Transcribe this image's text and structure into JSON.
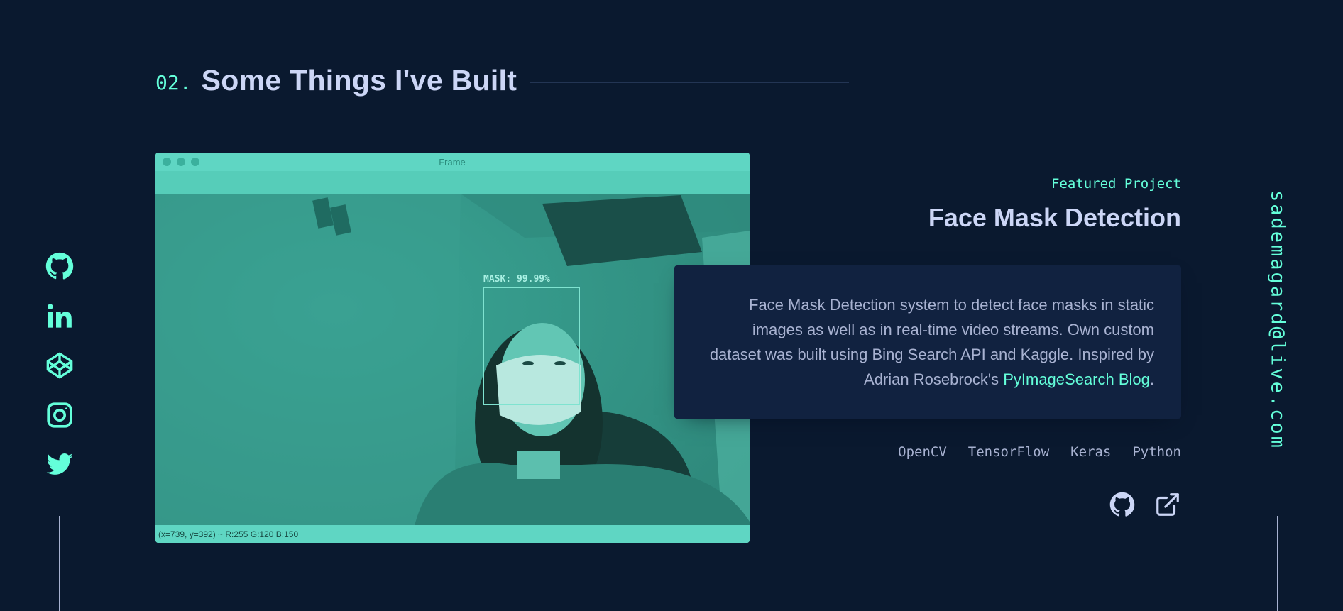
{
  "section": {
    "number": "02.",
    "title": "Some Things I've Built"
  },
  "project": {
    "overline": "Featured Project",
    "title": "Face Mask Detection",
    "description_pre": "Face Mask Detection system to detect face masks in static images as well as in real-time video streams. Own custom dataset was built using Bing Search API and Kaggle. Inspired by Adrian Rosebrock's ",
    "description_link": "PyImageSearch Blog",
    "description_post": ".",
    "tech": [
      "OpenCV",
      "TensorFlow",
      "Keras",
      "Python"
    ],
    "links": [
      {
        "icon": "github-icon"
      },
      {
        "icon": "external-link-icon"
      }
    ],
    "screenshot": {
      "window_title": "Frame",
      "detection_label": "MASK: 99.99%",
      "status_bar": "(x=739, y=392) ~ R:255 G:120 B:150"
    }
  },
  "social": [
    {
      "icon": "github-icon"
    },
    {
      "icon": "linkedin-icon"
    },
    {
      "icon": "codepen-icon"
    },
    {
      "icon": "instagram-icon"
    },
    {
      "icon": "twitter-icon"
    }
  ],
  "email": "sademagard@live.com",
  "colors": {
    "background": "#0a192f",
    "accent": "#64ffda",
    "heading": "#ccd6f6",
    "body": "#a8b2d1",
    "panel": "#112240"
  }
}
